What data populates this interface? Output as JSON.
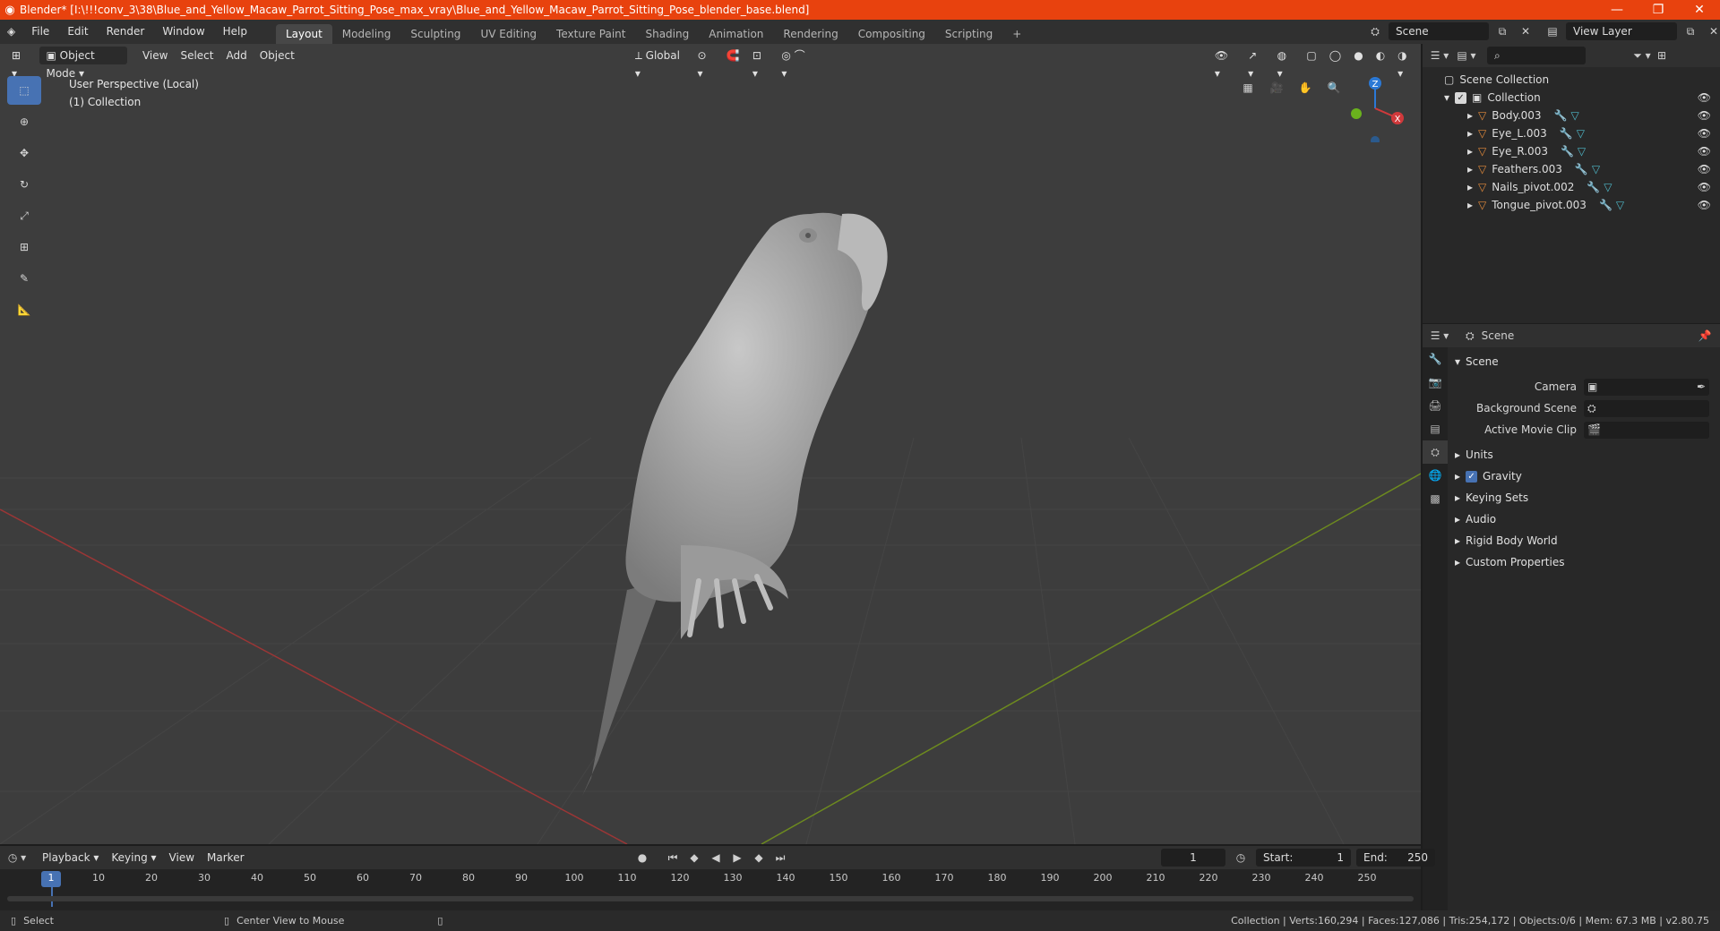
{
  "window": {
    "title": "Blender* [I:\\!!!conv_3\\38\\Blue_and_Yellow_Macaw_Parrot_Sitting_Pose_max_vray\\Blue_and_Yellow_Macaw_Parrot_Sitting_Pose_blender_base.blend]",
    "minimize": "—",
    "maximize": "❐",
    "close": "✕"
  },
  "menu": [
    "File",
    "Edit",
    "Render",
    "Window",
    "Help"
  ],
  "workspaces": {
    "tabs": [
      "Layout",
      "Modeling",
      "Sculpting",
      "UV Editing",
      "Texture Paint",
      "Shading",
      "Animation",
      "Rendering",
      "Compositing",
      "Scripting"
    ],
    "add": "+"
  },
  "scene_selector": {
    "value": "Scene"
  },
  "view_layer_selector": {
    "value": "View Layer"
  },
  "viewport_header": {
    "mode": "Object Mode",
    "menus": [
      "View",
      "Select",
      "Add",
      "Object"
    ],
    "transform_orientation": "Global"
  },
  "viewport": {
    "info_line1": "User Perspective (Local)",
    "info_line2": "(1) Collection"
  },
  "gizmo": {
    "z": "Z",
    "x": "X"
  },
  "outliner": {
    "search_placeholder": "",
    "scene_collection": "Scene Collection",
    "collection": "Collection",
    "objects": [
      "Body.003",
      "Eye_L.003",
      "Eye_R.003",
      "Feathers.003",
      "Nails_pivot.002",
      "Tongue_pivot.003"
    ]
  },
  "properties": {
    "header": "Scene",
    "section": "Scene",
    "camera_label": "Camera",
    "background_scene_label": "Background Scene",
    "active_movie_clip_label": "Active Movie Clip",
    "subsections": [
      "Units",
      "Gravity",
      "Keying Sets",
      "Audio",
      "Rigid Body World",
      "Custom Properties"
    ],
    "gravity_checked": true
  },
  "timeline": {
    "menus": [
      "Playback",
      "Keying",
      "View",
      "Marker"
    ],
    "current_frame": "1",
    "start_label": "Start:",
    "start_value": "1",
    "end_label": "End:",
    "end_value": "250",
    "ticks": [
      "1",
      "10",
      "20",
      "30",
      "40",
      "50",
      "60",
      "70",
      "80",
      "90",
      "100",
      "110",
      "120",
      "130",
      "140",
      "150",
      "160",
      "170",
      "180",
      "190",
      "200",
      "210",
      "220",
      "230",
      "240",
      "250"
    ]
  },
  "statusbar": {
    "select": "Select",
    "center_view": "Center View to Mouse",
    "stats": "Collection | Verts:160,294 | Faces:127,086 | Tris:254,172 | Objects:0/6 | Mem: 67.3 MB | v2.80.75"
  },
  "colors": {
    "titlebar": "#e8420e",
    "accent": "#4772b3",
    "x_axis": "#c0393b",
    "y_axis": "#7f9f1e",
    "object_icon": "#e38a3b",
    "modifier_icon": "#4fb8c9"
  }
}
